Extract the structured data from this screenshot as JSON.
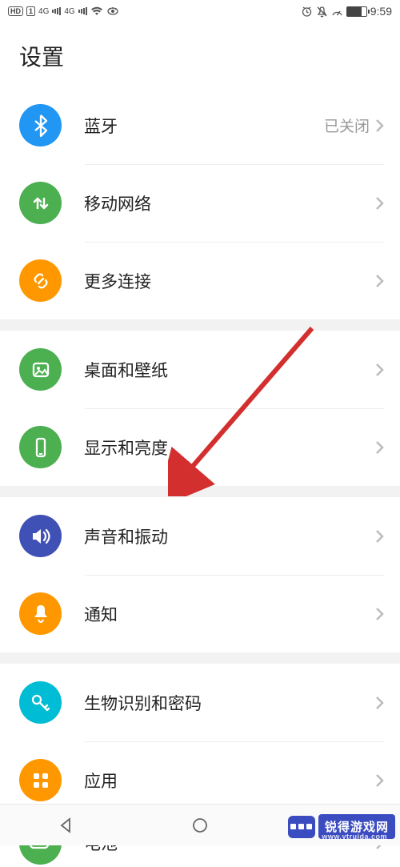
{
  "status": {
    "hd": "HD",
    "net1": "4G",
    "net2": "4G",
    "time": "9:59"
  },
  "page": {
    "title": "设置"
  },
  "groups": [
    {
      "rows": [
        {
          "id": "bluetooth",
          "label": "蓝牙",
          "value": "已关闭",
          "icon": "bluetooth",
          "color": "#2196f3"
        },
        {
          "id": "mobile-network",
          "label": "移动网络",
          "value": "",
          "icon": "updown",
          "color": "#4caf50"
        },
        {
          "id": "more-connections",
          "label": "更多连接",
          "value": "",
          "icon": "link",
          "color": "#ff9800"
        }
      ]
    },
    {
      "rows": [
        {
          "id": "home-wallpaper",
          "label": "桌面和壁纸",
          "value": "",
          "icon": "image",
          "color": "#4caf50"
        },
        {
          "id": "display-brightness",
          "label": "显示和亮度",
          "value": "",
          "icon": "phone",
          "color": "#4caf50"
        }
      ]
    },
    {
      "rows": [
        {
          "id": "sound-vibration",
          "label": "声音和振动",
          "value": "",
          "icon": "volume",
          "color": "#3f51b5"
        },
        {
          "id": "notifications",
          "label": "通知",
          "value": "",
          "icon": "bell",
          "color": "#ff9800"
        }
      ]
    },
    {
      "rows": [
        {
          "id": "biometrics-password",
          "label": "生物识别和密码",
          "value": "",
          "icon": "key",
          "color": "#00bcd4"
        },
        {
          "id": "apps",
          "label": "应用",
          "value": "",
          "icon": "grid",
          "color": "#ff9800"
        },
        {
          "id": "battery",
          "label": "电池",
          "value": "",
          "icon": "battery",
          "color": "#4caf50"
        }
      ]
    }
  ],
  "watermark": {
    "brand": "锐得游戏网",
    "url": "www.ytruida.com"
  }
}
